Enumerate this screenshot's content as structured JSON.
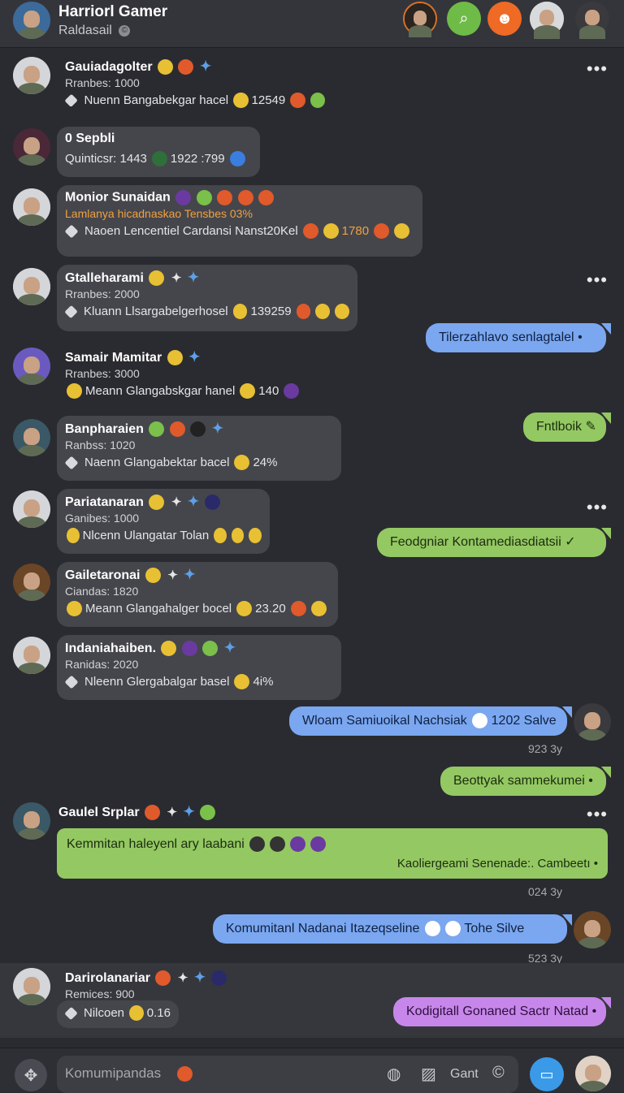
{
  "header": {
    "title": "Harriorl Gamer",
    "subtitle": "Raldasail"
  },
  "messages_left": [
    {
      "name": "Gauiadagolter",
      "stat": "Rranbes: 1000",
      "line": "Nuenn Bangabekgar hacel",
      "value": "12549"
    },
    {
      "name": "0 Sepbli",
      "stat": "Quinticsr: 1443",
      "value": "1922 :799"
    },
    {
      "name": "Monior Sunaidan",
      "stat": "Lamlanya hicadnaskao Tensbes 03%",
      "line": "Naoen Lencentiel Cardansi Nanst20Kel",
      "value": "1780"
    },
    {
      "name": "Gtalleharami",
      "stat": "Rranbes: 2000",
      "line": "Kluann Llsargabelgerhosel",
      "value": "139259"
    },
    {
      "name": "Samair Mamitar",
      "stat": "Rranbes: 3000",
      "line": "Meann Glangabskgar hanel",
      "value": "140"
    },
    {
      "name": "Banpharaien",
      "stat": "Ranbss: 1020",
      "line": "Naenn Glangabektar bacel",
      "value": "24%"
    },
    {
      "name": "Pariatanaran",
      "stat": "Ganibes: 1000",
      "line": "Nlcenn Ulangatar Tolan"
    },
    {
      "name": "Gailetaronai",
      "stat": "Ciandas: 1820",
      "line": "Meann Glangahalger bocel",
      "value": "23.20"
    },
    {
      "name": "Indaniahaiben.",
      "stat": "Ranidas: 2020",
      "line": "Nleenn Glergabalgar basel",
      "value": "4i%"
    },
    {
      "name": "Gaulel Srplar"
    },
    {
      "name": "Darirolanariar",
      "stat": "Remices: 900",
      "line": "Nilcoen",
      "value": "0.16"
    }
  ],
  "bubbles": [
    {
      "text": "Tilerzahlavo senlagtalel"
    },
    {
      "text": "Fntlboik"
    },
    {
      "text": "Feodgniar Kontamediasdiatsii"
    },
    {
      "text": "Wloam Samiuoikal Nachsiak",
      "extra": "1202 Salve"
    },
    {
      "text": "Beottyak sammekumei"
    },
    {
      "text": "Komumitanl Nadanai Itazeqseline",
      "extra": "Tohe Silve"
    },
    {
      "text": "Kodigitall Gonaned Sactr Natad"
    }
  ],
  "timestamps": [
    "923 3y",
    "024 3y",
    "523 3y"
  ],
  "green_block": {
    "text": "Kemmitan haleyenl ary laabani",
    "footer_text": "Kaoliergeami Senenade:. Cambeetı"
  },
  "composer": {
    "placeholder": "Komumipandas",
    "label": "Gant"
  },
  "colors": {
    "background": "#2a2b30",
    "card": "#45464c",
    "bubble_blue": "#7aa7f0",
    "bubble_green": "#94c862",
    "bubble_purple": "#c787ea"
  }
}
